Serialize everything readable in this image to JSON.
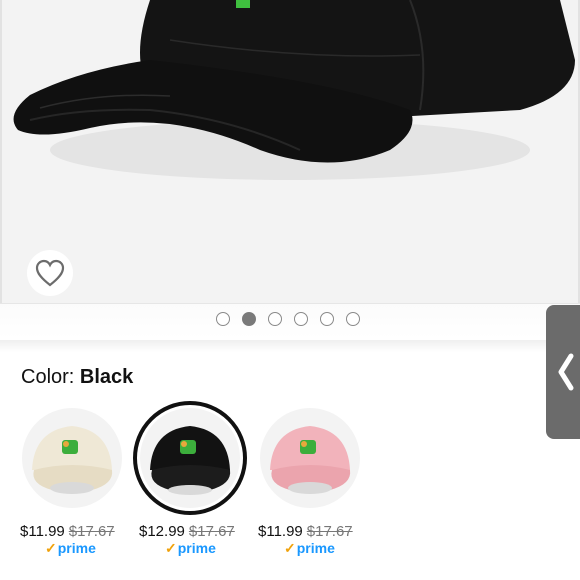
{
  "product": {
    "color_label": "Color:",
    "color_name": "Black",
    "images_count": 6,
    "active_image_index": 1
  },
  "variants": [
    {
      "color": "beige",
      "price": "$11.99",
      "list_price": "$17.67",
      "badge": "prime",
      "selected": false
    },
    {
      "color": "black",
      "price": "$12.99",
      "list_price": "$17.67",
      "badge": "prime",
      "selected": true
    },
    {
      "color": "pink",
      "price": "$11.99",
      "list_price": "$17.67",
      "badge": "prime",
      "selected": false
    }
  ],
  "icons": {
    "wishlist": "heart-icon",
    "side_tab": "chevron-left-icon",
    "prime_check": "check-icon"
  },
  "colors": {
    "prime_blue": "#1a98ff",
    "prime_check": "#f0a20c",
    "cap_black": "#121212",
    "cap_beige": "#efe8d6",
    "cap_pink": "#f2b3bb"
  }
}
